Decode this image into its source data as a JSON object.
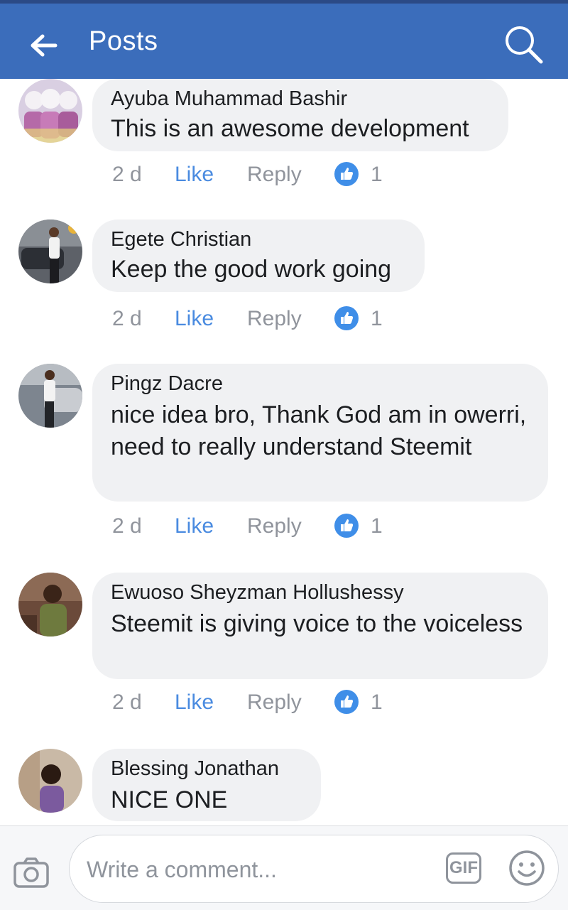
{
  "header": {
    "title": "Posts"
  },
  "comments": [
    {
      "author": "Ayuba Muhammad Bashir",
      "text": "This is an awesome development",
      "time": "2 d",
      "like_label": "Like",
      "reply_label": "Reply",
      "likes": "1"
    },
    {
      "author": "Egete Christian",
      "text": "Keep the good work going",
      "time": "2 d",
      "like_label": "Like",
      "reply_label": "Reply",
      "likes": "1"
    },
    {
      "author": "Pingz Dacre",
      "text": "nice idea bro, Thank God am in owerri, need to really understand Steemit",
      "time": "2 d",
      "like_label": "Like",
      "reply_label": "Reply",
      "likes": "1"
    },
    {
      "author": "Ewuoso Sheyzman Hollushessy",
      "text": "Steemit is giving voice to the voiceless",
      "time": "2 d",
      "like_label": "Like",
      "reply_label": "Reply",
      "likes": "1"
    },
    {
      "author": "Blessing Jonathan",
      "text": "NICE ONE"
    }
  ],
  "composer": {
    "placeholder": "Write a comment...",
    "gif_label": "GIF"
  },
  "colors": {
    "header": "#3b6dbb",
    "like": "#4a8be0",
    "muted": "#90949c",
    "bubble": "#f0f1f3"
  }
}
